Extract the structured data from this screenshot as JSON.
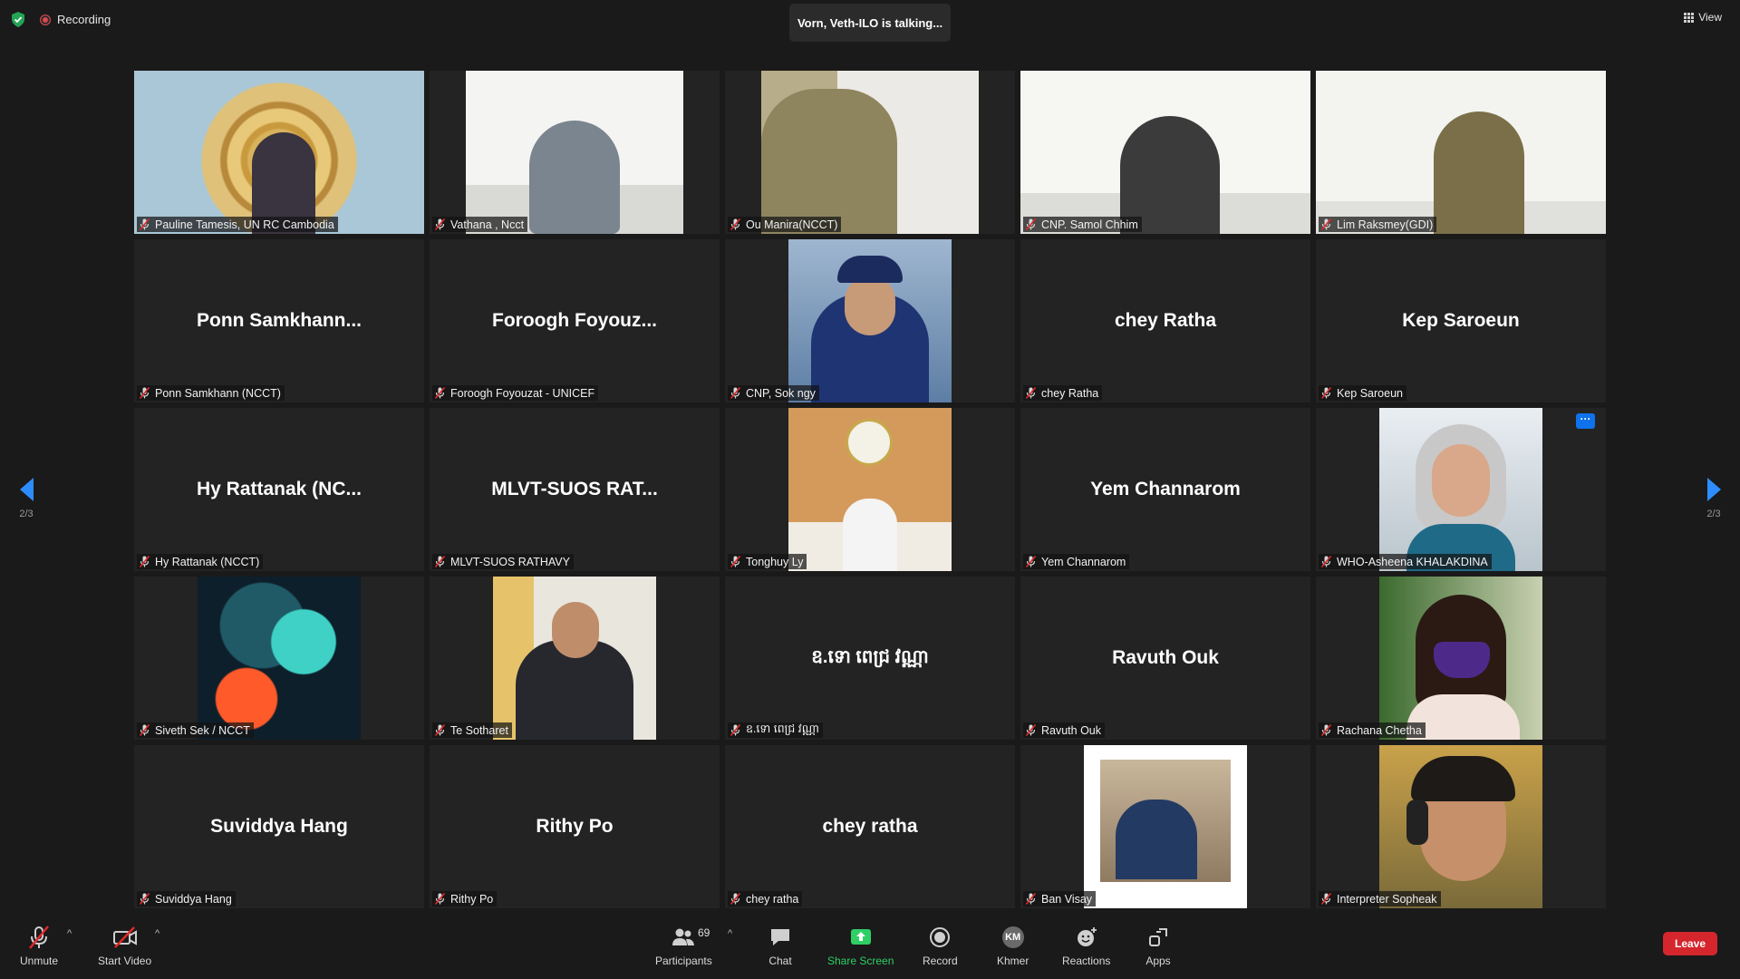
{
  "top": {
    "recording": "Recording",
    "talking": "Vorn, Veth-ILO is talking...",
    "view": "View"
  },
  "tiles": {
    "t0": {
      "label": "Pauline Tamesis, UN RC Cambodia"
    },
    "t1": {
      "label": "Vathana , Ncct"
    },
    "t2": {
      "label": "Ou Manira(NCCT)"
    },
    "t3": {
      "label": "CNP. Samol Chhim"
    },
    "t4": {
      "label": "Lim Raksmey(GDI)"
    },
    "t5": {
      "label": "Ponn Samkhann (NCCT)",
      "big": "Ponn  Samkhann..."
    },
    "t6": {
      "label": "Foroogh Foyouzat - UNICEF",
      "big": "Foroogh  Foyouz..."
    },
    "t7": {
      "label": "CNP, Sok ngy"
    },
    "t8": {
      "label": "chey Ratha",
      "big": "chey Ratha"
    },
    "t9": {
      "label": "Kep Saroeun",
      "big": "Kep Saroeun"
    },
    "t10": {
      "label": "Hy Rattanak (NCCT)",
      "big": "Hy Rattanak (NC..."
    },
    "t11": {
      "label": "MLVT-SUOS RATHAVY",
      "big": "MLVT-SUOS  RAT..."
    },
    "t12": {
      "label": "Tonghuy Ly"
    },
    "t13": {
      "label": "Yem Channarom",
      "big": "Yem Channarom"
    },
    "t14": {
      "label": "WHO-Asheena KHALAKDINA"
    },
    "t15": {
      "label": "Siveth Sek / NCCT"
    },
    "t16": {
      "label": "Te Sotharet"
    },
    "t17": {
      "label": "ឧ.ទោ ពេជ្រ វណ្ណា",
      "big": "ឧ.ទោ ពេជ្រ វណ្ណា"
    },
    "t18": {
      "label": "Ravuth Ouk",
      "big": "Ravuth Ouk"
    },
    "t19": {
      "label": "Rachana Chetha"
    },
    "t20": {
      "label": "Suviddya Hang",
      "big": "Suviddya Hang"
    },
    "t21": {
      "label": "Rithy Po",
      "big": "Rithy Po"
    },
    "t22": {
      "label": "chey ratha",
      "big": "chey ratha"
    },
    "t23": {
      "label": "Ban Visay"
    },
    "t24": {
      "label": "Interpreter Sopheak"
    }
  },
  "nav": {
    "left_page": "2/3",
    "right_page": "2/3"
  },
  "toolbar": {
    "unmute": "Unmute",
    "start_video": "Start Video",
    "participants": "Participants",
    "participants_count": "69",
    "chat": "Chat",
    "share_screen": "Share Screen",
    "record": "Record",
    "language_badge": "KM",
    "language": "Khmer",
    "reactions": "Reactions",
    "apps": "Apps",
    "leave": "Leave"
  },
  "colors": {
    "accent": "#2d8cff",
    "share_green": "#2fcf65",
    "leave_red": "#d4262c",
    "tile_bg": "#232323"
  }
}
